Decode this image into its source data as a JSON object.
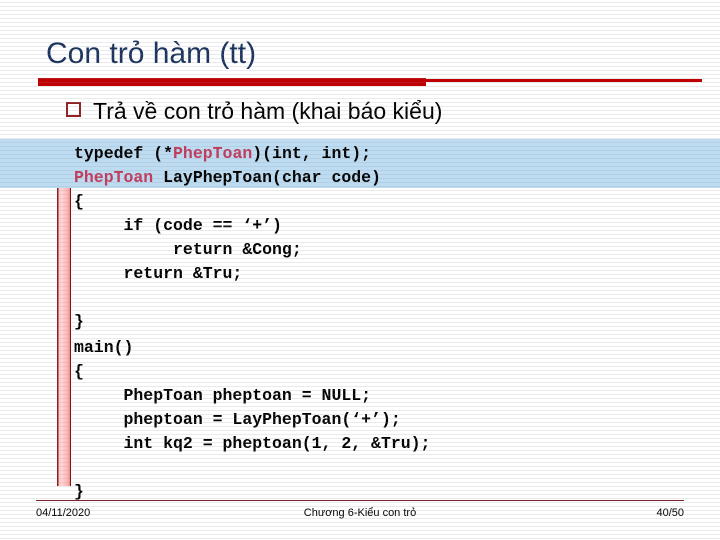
{
  "slide": {
    "title": "Con trỏ hàm (tt)",
    "bullet": {
      "marker": "square-bullet-icon",
      "text": "Trả về con trỏ hàm (khai báo kiểu)"
    },
    "code_top": {
      "lines": [
        {
          "segments": [
            {
              "text": "typedef (*",
              "style": "plain"
            },
            {
              "text": "PhepToan",
              "style": "type"
            },
            {
              "text": ")(int, int);",
              "style": "plain"
            }
          ]
        },
        {
          "segments": [
            {
              "text": "PhepToan",
              "style": "type"
            },
            {
              "text": " LayPhepToan(char code)",
              "style": "plain"
            }
          ]
        },
        {
          "segments": [
            {
              "text": "{",
              "style": "plain"
            }
          ]
        },
        {
          "segments": [
            {
              "text": "     if (code == ‘+’)",
              "style": "plain"
            }
          ]
        },
        {
          "segments": [
            {
              "text": "          return &Cong;",
              "style": "plain"
            }
          ]
        },
        {
          "segments": [
            {
              "text": "     return &Tru;",
              "style": "plain"
            }
          ]
        },
        {
          "segments": [
            {
              "text": "",
              "style": "plain"
            }
          ]
        },
        {
          "segments": [
            {
              "text": "}",
              "style": "plain"
            }
          ]
        }
      ]
    },
    "code_main": {
      "lines": [
        {
          "segments": [
            {
              "text": "main()",
              "style": "plain"
            }
          ]
        },
        {
          "segments": [
            {
              "text": "{",
              "style": "plain"
            }
          ]
        },
        {
          "segments": [
            {
              "text": "     PhepToan pheptoan = NULL;",
              "style": "plain"
            }
          ]
        },
        {
          "segments": [
            {
              "text": "     pheptoan = LayPhepToan(‘+’);",
              "style": "plain"
            }
          ]
        },
        {
          "segments": [
            {
              "text": "     int kq2 = pheptoan(1, 2, &Tru);",
              "style": "plain"
            }
          ]
        },
        {
          "segments": [
            {
              "text": "",
              "style": "plain"
            }
          ]
        },
        {
          "segments": [
            {
              "text": "}",
              "style": "plain"
            }
          ]
        }
      ]
    },
    "footer": {
      "date": "04/11/2020",
      "center": "Chương 6-Kiểu con trỏ",
      "page": "40/50"
    },
    "colors": {
      "title": "#1b335c",
      "rule": "#c00000",
      "bullet_marker": "#932020",
      "highlight": "#bddcf2",
      "code_type": "#c23a5c",
      "footer_rule": "#7d2430"
    }
  }
}
